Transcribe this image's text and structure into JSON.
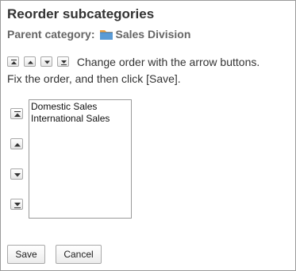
{
  "dialog": {
    "title": "Reorder subcategories",
    "parent_label": "Parent category:",
    "parent_name": "Sales Division",
    "instruction_line1": "Change order with the arrow buttons.",
    "instruction_line2": "Fix the order, and then click [Save]."
  },
  "order_controls": {
    "icons": [
      "move-to-top-icon",
      "move-up-icon",
      "move-down-icon",
      "move-to-bottom-icon"
    ]
  },
  "subcategories": [
    "Domestic Sales",
    "International Sales"
  ],
  "buttons": {
    "save": "Save",
    "cancel": "Cancel"
  },
  "colors": {
    "folder_blue": "#5b9bd5",
    "folder_orange": "#f0a040",
    "text_gray": "#666666"
  }
}
